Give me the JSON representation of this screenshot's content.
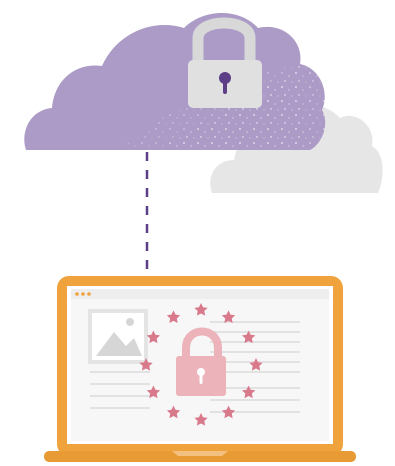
{
  "colors": {
    "cloud_primary": "#ac9bc7",
    "cloud_secondary": "#e6e6e6",
    "cloud_lock": "#e0e0e0",
    "keyhole_cloud": "#5c3f87",
    "connector": "#5c3f87",
    "laptop_frame": "#f0a23c",
    "laptop_base": "#e89a34",
    "screen_bg": "#f7f7f7",
    "star": "#d97a8c",
    "lock_eu": "#ecb3bb"
  },
  "icons": {
    "cloud_primary": "cloud-icon",
    "cloud_secondary": "cloud-icon",
    "cloud_lock": "padlock-icon",
    "connector": "dashed-connector",
    "laptop": "laptop-icon",
    "screen_image": "image-placeholder-icon",
    "eu_stars": "eu-stars-icon",
    "eu_lock": "padlock-icon"
  }
}
